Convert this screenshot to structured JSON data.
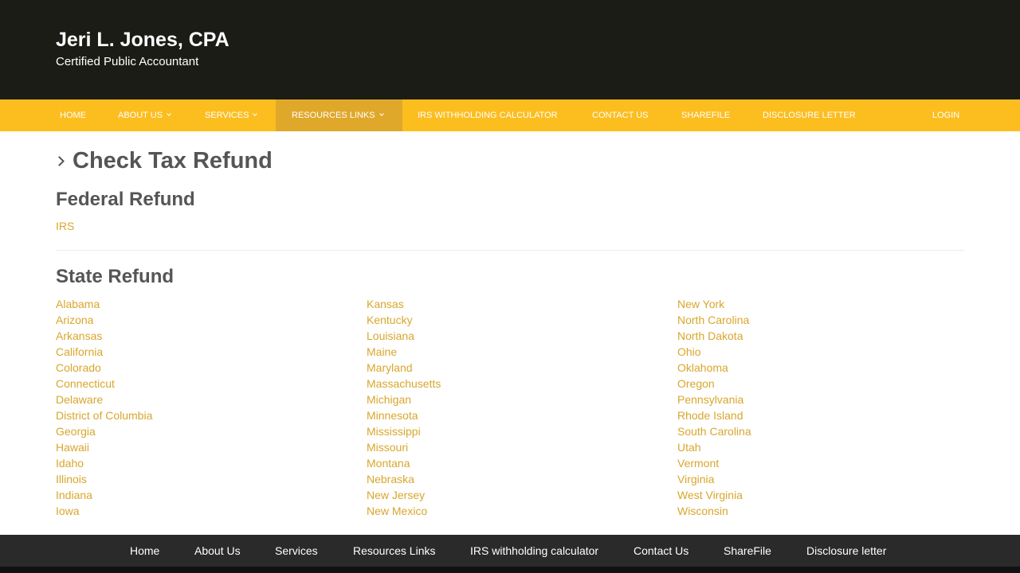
{
  "header": {
    "name": "Jeri L. Jones, CPA",
    "tagline": "Certified Public Accountant"
  },
  "nav": {
    "home": "Home",
    "about": "About Us",
    "services": "Services",
    "resources": "Resources Links",
    "irs_calc": "IRS withholding calculator",
    "contact": "Contact Us",
    "sharefile": "ShareFile",
    "disclosure": "Disclosure letter",
    "login": "Login",
    "active": "Resources Links"
  },
  "main": {
    "title": "Check Tax Refund",
    "federal": {
      "heading": "Federal Refund",
      "link": "IRS"
    },
    "state": {
      "heading": "State Refund",
      "columns": [
        [
          "Alabama",
          "Arizona",
          "Arkansas",
          "California",
          "Colorado",
          "Connecticut",
          "Delaware",
          "District of Columbia",
          "Georgia",
          "Hawaii",
          "Idaho",
          "Illinois",
          "Indiana",
          "Iowa"
        ],
        [
          "Kansas",
          "Kentucky",
          "Louisiana",
          "Maine",
          "Maryland",
          "Massachusetts",
          "Michigan",
          "Minnesota",
          "Mississippi",
          "Missouri",
          "Montana",
          "Nebraska",
          "New Jersey",
          "New Mexico"
        ],
        [
          "New York",
          "North Carolina",
          "North Dakota",
          "Ohio",
          "Oklahoma",
          "Oregon",
          "Pennsylvania",
          "Rhode Island",
          "South Carolina",
          "Utah",
          "Vermont",
          "Virginia",
          "West Virginia",
          "Wisconsin"
        ]
      ]
    }
  },
  "footer": {
    "home": "Home",
    "about": "About Us",
    "services": "Services",
    "resources": "Resources Links",
    "irs_calc": "IRS withholding calculator",
    "contact": "Contact Us",
    "sharefile": "ShareFile",
    "disclosure": "Disclosure letter"
  },
  "colors": {
    "nav_bg": "#fcbe1f",
    "nav_active": "#e0a82b",
    "header_bg": "#1b1c16",
    "link": "#d9a62c",
    "footer_bg": "#2a2a2a"
  },
  "icons": {
    "dropdown": "chevron-down-icon",
    "title_marker": "chevron-right-icon"
  }
}
